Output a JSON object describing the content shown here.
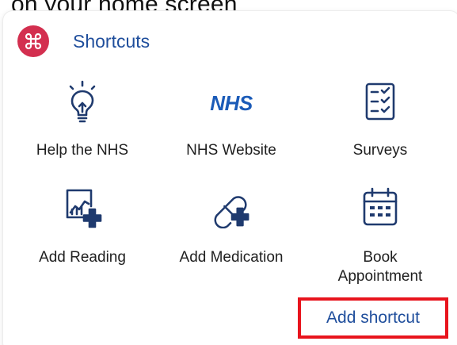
{
  "caption": "on your home screen",
  "shortcuts": {
    "title": "Shortcuts",
    "header_icon": "command-key-icon",
    "accent_color": "#d32f4f",
    "title_color": "#1f4e9c",
    "items": [
      {
        "label": "Help the NHS",
        "icon": "lightbulb-icon"
      },
      {
        "label": "NHS Website",
        "icon": "nhs-logo-icon",
        "logo_text": "NHS"
      },
      {
        "label": "Surveys",
        "icon": "checklist-icon"
      },
      {
        "label": "Add Reading",
        "icon": "chart-add-icon"
      },
      {
        "label": "Add Medication",
        "icon": "pill-add-icon"
      },
      {
        "label": "Book\nAppointment",
        "icon": "calendar-icon"
      }
    ],
    "add_shortcut_label": "Add shortcut",
    "highlight_color": "#e8141d"
  }
}
